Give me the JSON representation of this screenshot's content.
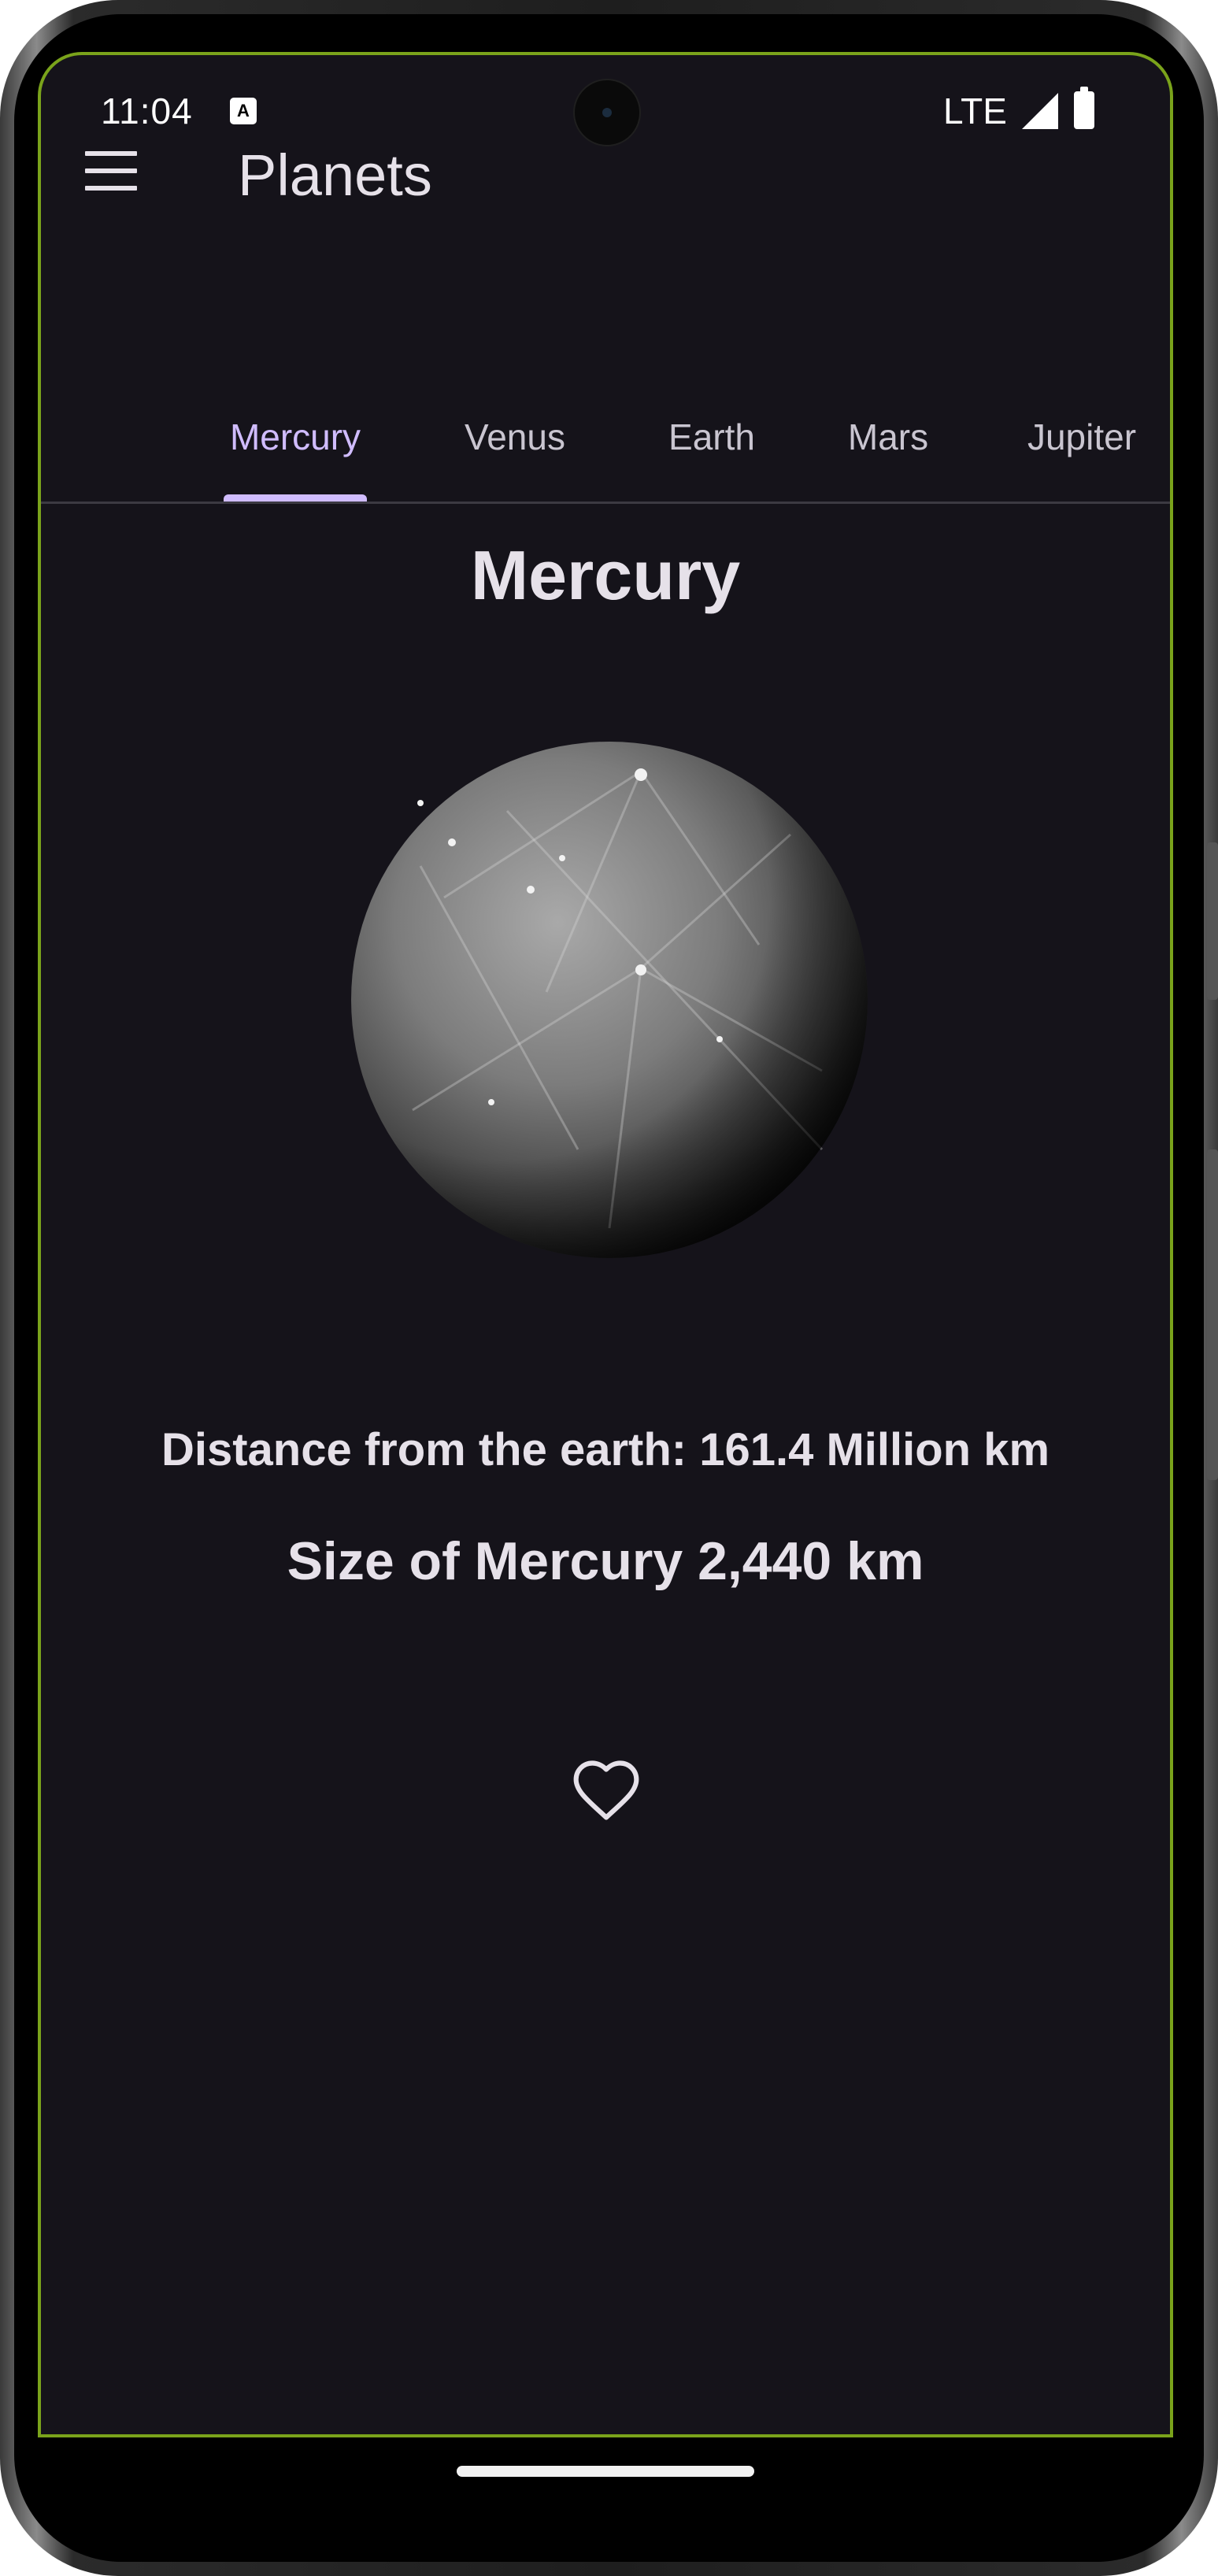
{
  "status_bar": {
    "time": "11:04",
    "notification_icon": "A",
    "network": "LTE",
    "icons": [
      "signal-icon",
      "battery-icon"
    ]
  },
  "app_bar": {
    "menu_icon": "menu-icon",
    "title": "Planets"
  },
  "tabs": [
    {
      "label": "Mercury",
      "selected": true
    },
    {
      "label": "Venus",
      "selected": false
    },
    {
      "label": "Earth",
      "selected": false
    },
    {
      "label": "Mars",
      "selected": false
    },
    {
      "label": "Jupiter",
      "selected": false
    }
  ],
  "planet": {
    "name": "Mercury",
    "distance_text": "Distance from the earth: 161.4 Million km",
    "size_text": "Size of Mercury 2,440 km",
    "favorite_icon": "heart-outline-icon"
  },
  "colors": {
    "background": "#15131a",
    "accent": "#d0bcff",
    "text": "#e6e1e9",
    "frame_outline": "#7aa31b"
  }
}
